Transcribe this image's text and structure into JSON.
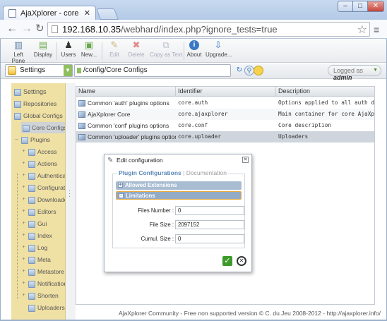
{
  "browser": {
    "tab_title": "AjaXplorer - core",
    "url_host": "192.168.10.35",
    "url_rest": "/webhard/index.php?ignore_tests=true"
  },
  "toolbar": {
    "buttons": [
      {
        "label": "Left Pane",
        "icon": "left-pane-icon"
      },
      {
        "label": "Display",
        "icon": "display-icon"
      },
      {
        "label": "Users",
        "icon": "users-icon"
      },
      {
        "label": "New...",
        "icon": "new-icon"
      },
      {
        "label": "Edit",
        "icon": "edit-icon"
      },
      {
        "label": "Delete",
        "icon": "delete-icon"
      },
      {
        "label": "Copy as Text",
        "icon": "copy-icon"
      },
      {
        "label": "About",
        "icon": "about-icon"
      },
      {
        "label": "Upgrade...",
        "icon": "upgrade-icon"
      }
    ]
  },
  "location": {
    "workspace": "Settings",
    "path": "/config/Core Configs",
    "logged_prefix": "Logged as",
    "logged_user": "admin"
  },
  "sidebar": {
    "items": [
      {
        "label": "Settings"
      },
      {
        "label": "Repositories"
      },
      {
        "label": "Global Configs"
      },
      {
        "label": "Core Configs"
      },
      {
        "label": "Plugins"
      },
      {
        "label": "Access"
      },
      {
        "label": "Actions"
      },
      {
        "label": "Authentication"
      },
      {
        "label": "Configurations"
      },
      {
        "label": "Downloaders"
      },
      {
        "label": "Editors"
      },
      {
        "label": "Gui"
      },
      {
        "label": "Index"
      },
      {
        "label": "Log"
      },
      {
        "label": "Meta"
      },
      {
        "label": "Metastore"
      },
      {
        "label": "Notifications"
      },
      {
        "label": "Shorten"
      },
      {
        "label": "Uploaders"
      }
    ]
  },
  "table": {
    "columns": [
      "Name",
      "Identifier",
      "Description"
    ],
    "rows": [
      {
        "name": "Common 'auth' plugins options",
        "id": "core.auth",
        "desc": "Options applied to all auth drivers"
      },
      {
        "name": "AjaXplorer Core",
        "id": "core.ajaxplorer",
        "desc": "Main container for core AjaXplorer setting"
      },
      {
        "name": "Common 'conf' plugins options",
        "id": "core.conf",
        "desc": "Core description"
      },
      {
        "name": "Common 'uploader' plugins options",
        "id": "core.uploader",
        "desc": "Uploaders"
      }
    ]
  },
  "dialog": {
    "title": "Edit configuration",
    "tab_active": "Plugin Configurations",
    "tab_sep": "|",
    "tab_inactive": "Documentation",
    "section1": "Allowed Extensions",
    "section2": "Limitations",
    "fields": [
      {
        "label": "Files Number :",
        "value": "0"
      },
      {
        "label": "File Size :",
        "value": "2097152"
      },
      {
        "label": "Cumul. Size :",
        "value": "0"
      }
    ]
  },
  "footer": "AjaXplorer Community - Free non supported version © C. du Jeu 2008-2012 - http://ajaxplorer.info/"
}
